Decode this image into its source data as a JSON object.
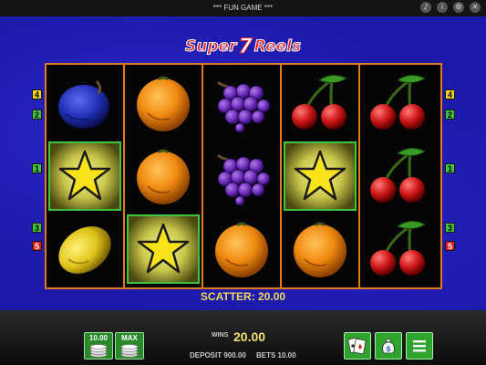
{
  "header": {
    "title": "*** FUN GAME ***"
  },
  "top_icons": [
    {
      "name": "sound-icon",
      "glyph": "♪"
    },
    {
      "name": "info-icon",
      "glyph": "i"
    },
    {
      "name": "settings-icon",
      "glyph": "⚙"
    },
    {
      "name": "close-icon",
      "glyph": "✕"
    }
  ],
  "logo": {
    "part1": "Super",
    "seven": "7",
    "part2": "Reels"
  },
  "reels": [
    [
      "plum",
      "star",
      "lemon"
    ],
    [
      "orange",
      "orange",
      "star"
    ],
    [
      "grapes",
      "grapes",
      "orange"
    ],
    [
      "cherry",
      "star",
      "orange"
    ],
    [
      "cherry",
      "cherry",
      "cherry"
    ]
  ],
  "winning_cells": [
    [
      0,
      1
    ],
    [
      1,
      2
    ],
    [
      3,
      1
    ]
  ],
  "paylines": {
    "left": [
      "4",
      "2",
      "1",
      "3",
      "5"
    ],
    "right": [
      "4",
      "2",
      "1",
      "3",
      "5"
    ]
  },
  "scatter_text": "SCATTER: 20.00",
  "controls": {
    "bet_button_label": "10.00",
    "max_button_label": "MAX",
    "wins_label": "WINS",
    "wins_value": "20.00",
    "deposit_text": "DEPOSIT 900.00",
    "bets_text": "BETS 10.00"
  },
  "colors": {
    "frame": "#e07a1a",
    "highlight": "#3ec43e",
    "background": "#1c18a8"
  }
}
